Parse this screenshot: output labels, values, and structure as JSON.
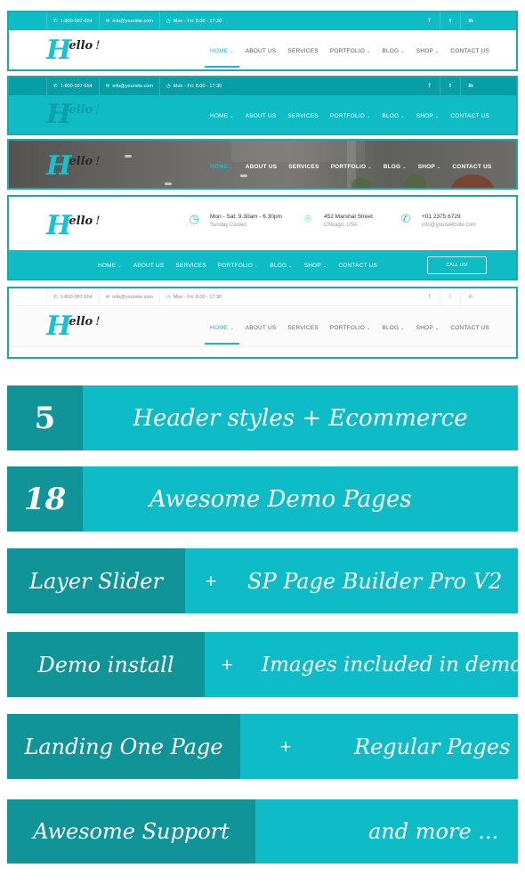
{
  "colors": {
    "accent": "#0fbcc5",
    "accent_dark": "#119497",
    "topbar_dark": "#089ea5",
    "border": "#1aa9ad",
    "logo_cyan": "#14c3d2"
  },
  "logo": {
    "first_letter": "H",
    "rest": "ello",
    "bang": "!"
  },
  "topbar": {
    "phone": "1-800-987-654",
    "email": "info@yoursite.com",
    "hours": "Mon - Fri: 8.00 - 17:30",
    "icons": {
      "phone": "phone-icon",
      "email": "envelope-icon",
      "hours": "clock-icon"
    },
    "social": [
      {
        "label": "f",
        "icon": "facebook-icon"
      },
      {
        "label": "t",
        "icon": "twitter-icon"
      },
      {
        "label": "in",
        "icon": "linkedin-icon"
      }
    ]
  },
  "nav": {
    "items": [
      {
        "label": "HOME",
        "dropdown": true,
        "active": true
      },
      {
        "label": "ABOUT US",
        "dropdown": false
      },
      {
        "label": "SERVICES",
        "dropdown": false
      },
      {
        "label": "PORTFOLIO",
        "dropdown": true
      },
      {
        "label": "BLOG",
        "dropdown": true
      },
      {
        "label": "SHOP",
        "dropdown": true
      },
      {
        "label": "CONTACT US",
        "dropdown": false
      }
    ],
    "chevron": "⌄"
  },
  "header4": {
    "hours": {
      "line1": "Mon - Sat: 9.30am - 6.30pm",
      "line2": "Sunday Closed",
      "icon": "clock-icon"
    },
    "address": {
      "line1": "452 Marshal Street",
      "line2": "Chicago, USA",
      "icon": "map-pin-icon"
    },
    "phone": {
      "line1": "+01 2375 6729",
      "line2": "info@yourwebsite.com",
      "icon": "phone-icon"
    },
    "call_button": "CALL US!"
  },
  "features": [
    {
      "left": "5",
      "plus": "",
      "right": "Header styles + Ecommerce"
    },
    {
      "left": "18",
      "plus": "",
      "right": "Awesome Demo Pages"
    },
    {
      "left": "Layer Slider",
      "plus": "+",
      "right": "SP Page Builder Pro V2"
    },
    {
      "left": "Demo install",
      "plus": "+",
      "right": "Images included in demo"
    },
    {
      "left": "Landing One Page",
      "plus": "+",
      "right": "Regular Pages"
    },
    {
      "left": "Awesome Support",
      "plus": "",
      "right": "and more ..."
    }
  ]
}
